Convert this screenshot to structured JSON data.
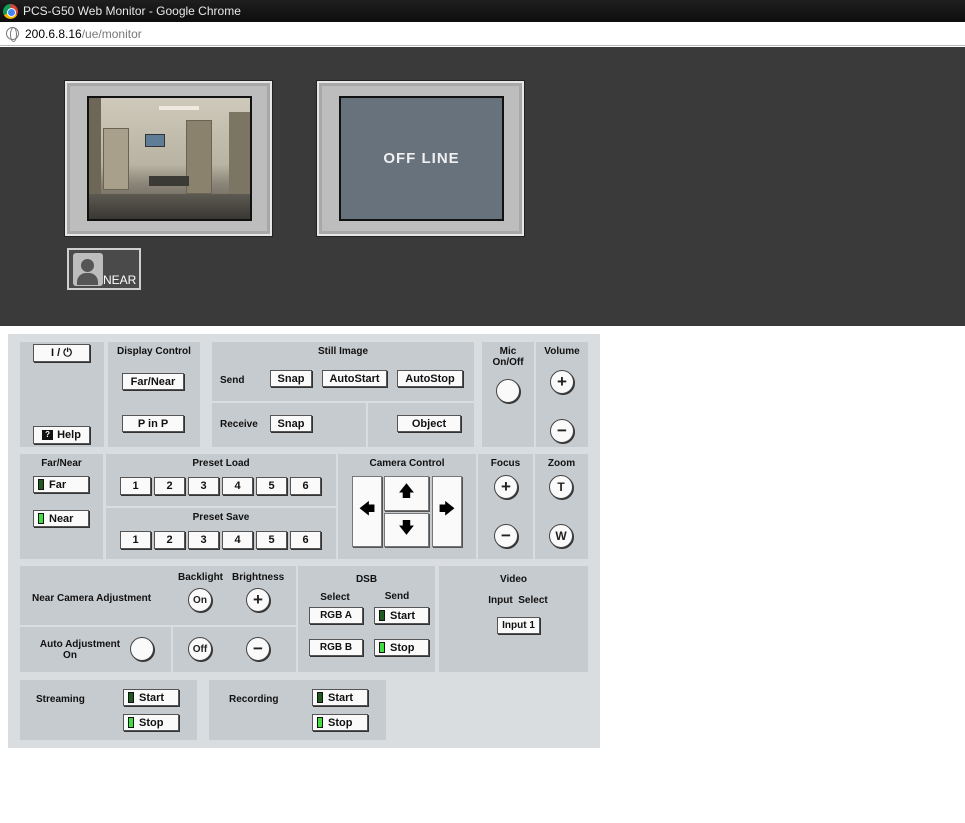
{
  "browser": {
    "window_title": "PCS-G50 Web Monitor - Google Chrome",
    "url_host": "200.6.8.16",
    "url_path": "/ue/monitor"
  },
  "monitor": {
    "offline_text": "OFF LINE",
    "near_label": "NEAR"
  },
  "controls": {
    "power": "I / ⏻",
    "help": "Help",
    "display_control": {
      "title": "Display Control",
      "far_near": "Far/Near",
      "pinp": "P in P"
    },
    "still_image": {
      "title": "Still Image",
      "send_label": "Send",
      "snap": "Snap",
      "autostart": "AutoStart",
      "autostop": "AutoStop",
      "receive_label": "Receive",
      "receive_snap": "Snap",
      "object": "Object"
    },
    "mic": {
      "title_line1": "Mic",
      "title_line2": "On/Off"
    },
    "volume": {
      "title": "Volume",
      "plus": "+",
      "minus": "−"
    },
    "far_near": {
      "title": "Far/Near",
      "far": "Far",
      "near": "Near"
    },
    "preset_load": {
      "title": "Preset Load",
      "buttons": [
        "1",
        "2",
        "3",
        "4",
        "5",
        "6"
      ]
    },
    "preset_save": {
      "title": "Preset Save",
      "buttons": [
        "1",
        "2",
        "3",
        "4",
        "5",
        "6"
      ]
    },
    "camera_control": {
      "title": "Camera Control"
    },
    "focus": {
      "title": "Focus",
      "plus": "+",
      "minus": "−"
    },
    "zoom": {
      "title": "Zoom",
      "tele": "T",
      "wide": "W"
    },
    "adjustment": {
      "near_camera": "Near Camera Adjustment",
      "backlight": "Backlight",
      "brightness": "Brightness",
      "on": "On",
      "off": "Off",
      "plus": "+",
      "minus": "−",
      "auto_line1": "Auto Adjustment",
      "auto_line2": "On"
    },
    "dsb": {
      "title": "DSB",
      "select": "Select",
      "send": "Send",
      "rgb_a": "RGB  A",
      "rgb_b": "RGB  B",
      "start": "Start",
      "stop": "Stop"
    },
    "video": {
      "title": "Video",
      "input_select": "Input  Select",
      "input": "Input 1"
    },
    "streaming": {
      "label": "Streaming",
      "start": "Start",
      "stop": "Stop"
    },
    "recording": {
      "label": "Recording",
      "start": "Start",
      "stop": "Stop"
    }
  }
}
